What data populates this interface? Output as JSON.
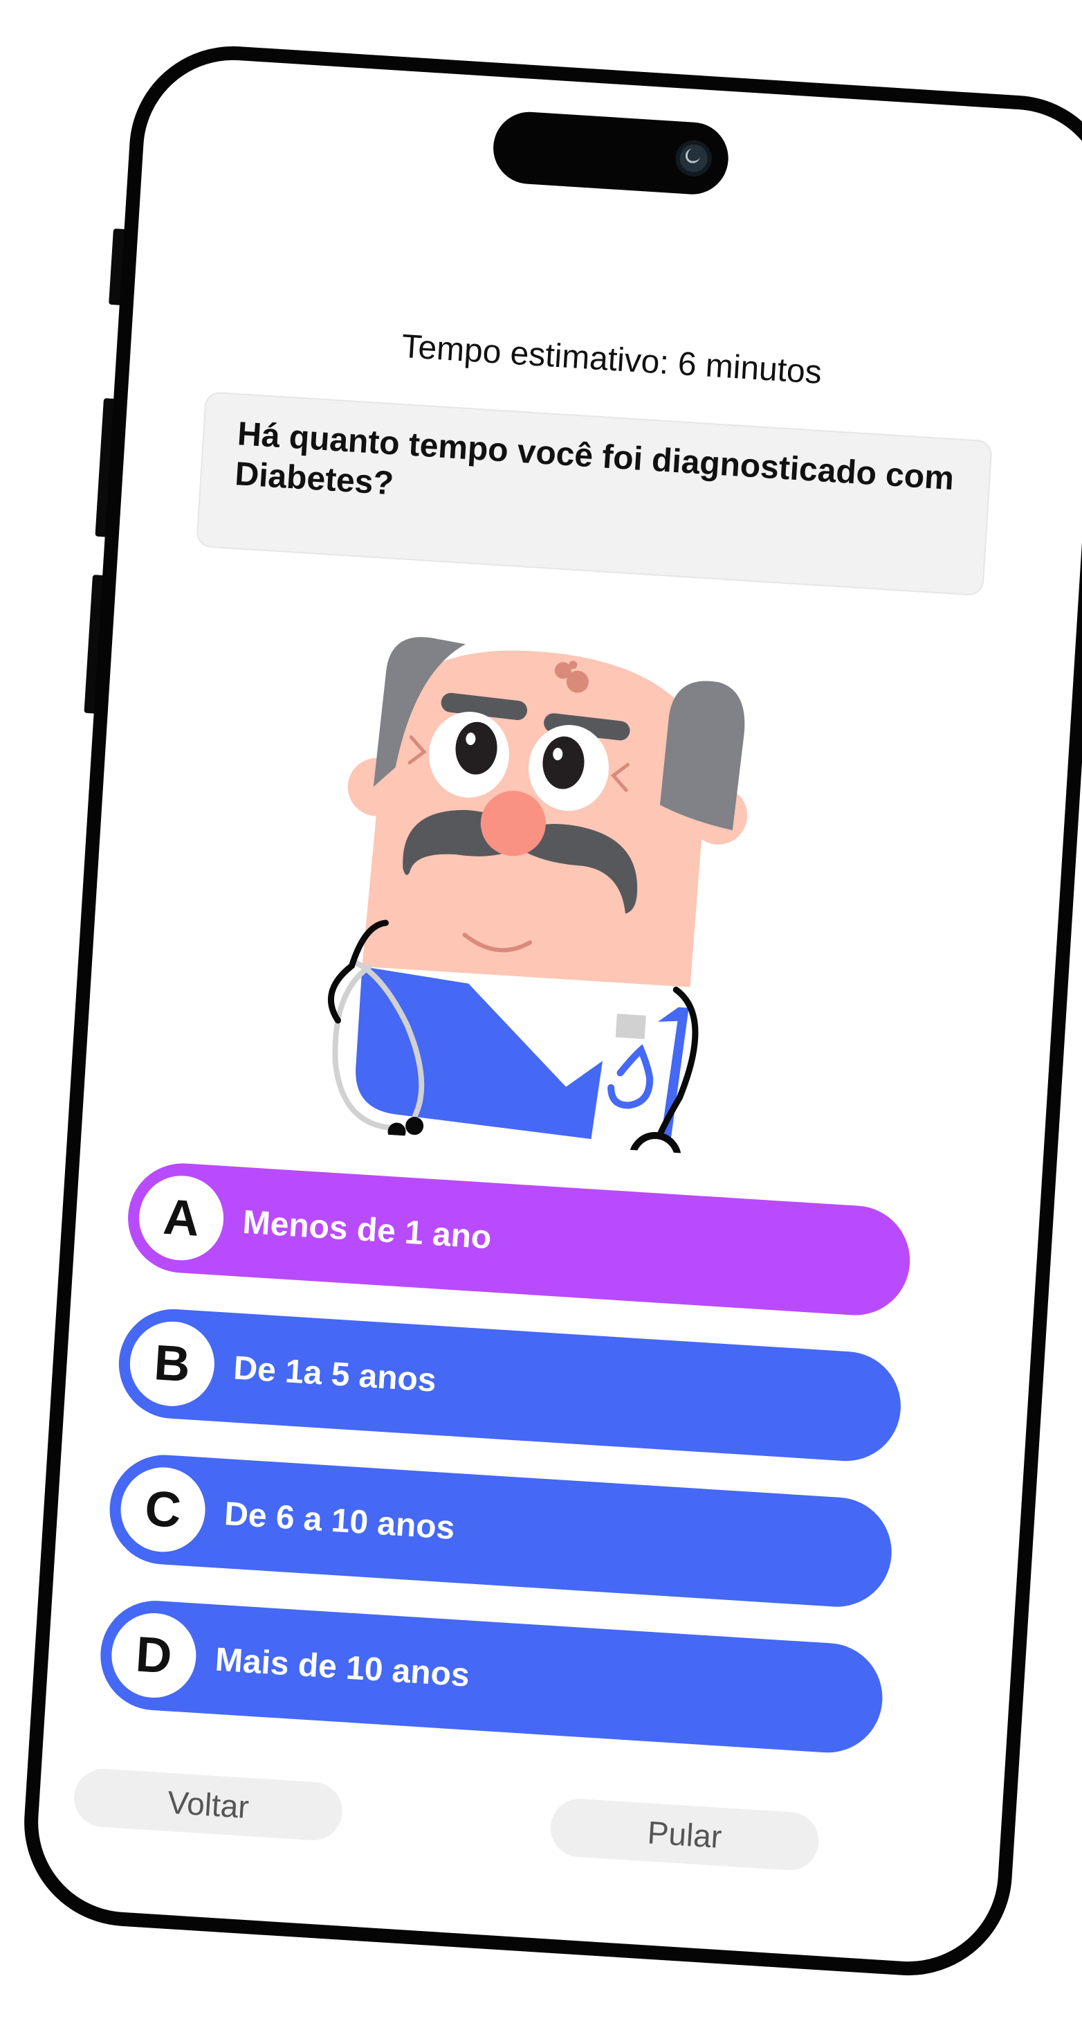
{
  "quiz": {
    "estimate_text": "Tempo estimativo: 6 minutos",
    "question": "Há quanto tempo você foi diagnosticado com Diabetes?",
    "options": [
      {
        "letter": "A",
        "label": "Menos de 1 ano",
        "color": "#b94bff"
      },
      {
        "letter": "B",
        "label": "De 1a 5 anos",
        "color": "#4568f5"
      },
      {
        "letter": "C",
        "label": "De 6 a 10 anos",
        "color": "#4568f5"
      },
      {
        "letter": "D",
        "label": "Mais de 10 anos",
        "color": "#4568f5"
      }
    ],
    "back_label": "Voltar",
    "skip_label": "Pular"
  },
  "illustration": {
    "icon": "doctor-mascot",
    "badge_icon": "drop-logo-icon"
  },
  "colors": {
    "selected_option": "#b94bff",
    "option": "#4568f5",
    "frame": "#050505"
  }
}
